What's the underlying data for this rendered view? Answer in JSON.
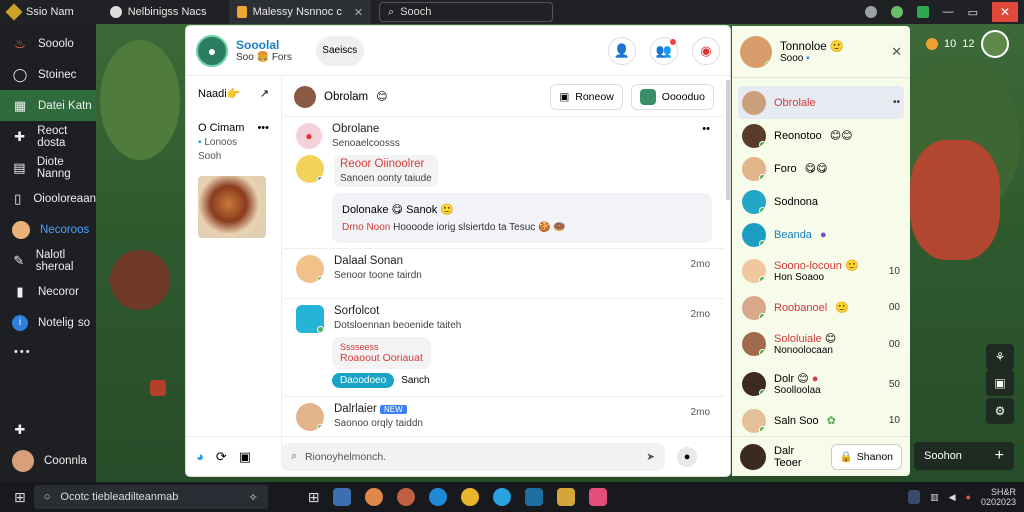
{
  "browser": {
    "tabs": [
      {
        "label": "Ssio Nam"
      },
      {
        "label": "Nelbinigss Nacs"
      },
      {
        "label": "Malessy Nsnnoc c"
      }
    ],
    "address_bar": "Sooch"
  },
  "left_nav": {
    "items": [
      {
        "label": "Sooolo",
        "icon": "flame-icon"
      },
      {
        "label": "Stoinec",
        "icon": "chat-icon"
      },
      {
        "label": "Datei Katn",
        "icon": "grid-icon"
      },
      {
        "label": "Reoct dosta",
        "icon": "puzzle-icon"
      },
      {
        "label": "Diote Nanng",
        "icon": "comments-icon"
      },
      {
        "label": "Oiooloreaan",
        "icon": "file-icon"
      },
      {
        "label": "Necoroos",
        "icon": "avatar"
      },
      {
        "label": "Nalotl sheroal",
        "icon": "tools-icon"
      },
      {
        "label": "Necoror",
        "icon": "bookmark-icon"
      },
      {
        "label": "Notelig",
        "suffix": "so",
        "icon": "info-icon"
      }
    ],
    "more": "•••",
    "user": "Coonnla"
  },
  "main": {
    "brand": {
      "title": "Sooolal",
      "subtitle": "Soo"
    },
    "header_pill": "Saeiscs",
    "left_column": {
      "title": "Naadi",
      "group_title": "O Cimam",
      "group_subtitle": "Lonoos",
      "group_subtitle2": "Sooh"
    },
    "feed_top": {
      "name": "Obrolam",
      "right_btn1": "Roneow",
      "right_btn2": "Ooooduo"
    },
    "posts": [
      {
        "name": "Obrolane",
        "sub": "Senoaelcoosss",
        "reply_title": "Reoor Oiinoolrer",
        "reply_sub": "Sanoen oonty taiude",
        "card_title": "Dolonake",
        "card_title2": "Sanok",
        "card_red": "Drno Noon",
        "card_body": "Hoooode iorig slsiertdo ta Tesuc"
      },
      {
        "name": "Dalaal Sonan",
        "sub": "Senoor toone tairdn",
        "time": "2mo"
      },
      {
        "name": "Sorfolcot",
        "sub": "Dotsloennan beoenide taiteh",
        "inner_top": "Sssseess",
        "inner_red": "Roaoout Ooriauat",
        "chip": "Daoodoeo",
        "chip_after": "Sanch",
        "time": "2mo"
      },
      {
        "name": "Dalrlaier",
        "badge": "NEW",
        "sub": "Saonoo orqly taiddn",
        "time": "2mo"
      }
    ],
    "composer_placeholder": "Rionoyhelmonch."
  },
  "contacts": {
    "header": {
      "name": "Tonnoloe",
      "sub": "Sooo"
    },
    "items": [
      {
        "name": "Obrolale",
        "selected": true,
        "more": "••",
        "color": "#d23b3b"
      },
      {
        "name": "Reonotoo"
      },
      {
        "name": "Foro"
      },
      {
        "name": "Sodnona"
      },
      {
        "name": "Beanda",
        "color": "#1a7fc1"
      },
      {
        "name": "Soono-locoun",
        "sub": "Hon Soaoo",
        "count": "10",
        "color": "#d23b3b"
      },
      {
        "name": "Roobanoel",
        "count": "00",
        "color": "#d23b3b"
      },
      {
        "name": "Sololuiale",
        "sub": "Nonoolocaan",
        "count": "00",
        "color": "#d23b3b"
      },
      {
        "name": "Dolr",
        "sub": "Soolloolaa",
        "count": "50"
      },
      {
        "name": "Saln Soo",
        "count": "10"
      }
    ],
    "footer_name": "Dalr Teoer",
    "search_label": "Shanon"
  },
  "hud": {
    "top_label": "10",
    "top_label2": "12",
    "newchat": "Soohon"
  },
  "taskbar": {
    "search_placeholder": "Ocotc tiebleadilteanmab",
    "tray_time": "SH&R",
    "tray_date": "0202023"
  }
}
